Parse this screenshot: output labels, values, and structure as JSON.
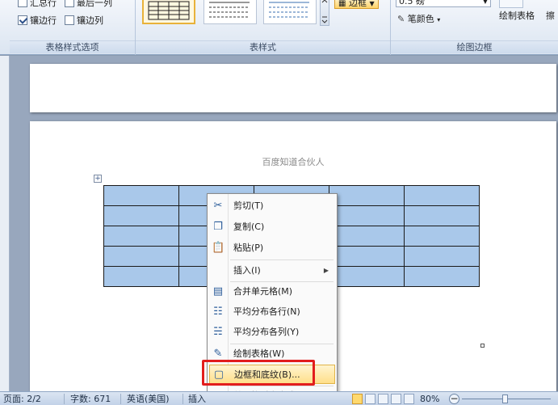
{
  "ribbon": {
    "style_options": {
      "caption": "表格样式选项",
      "items": [
        {
          "label": "汇总行",
          "checked": false
        },
        {
          "label": "最后一列",
          "checked": false
        },
        {
          "label": "镶边行",
          "checked": true
        },
        {
          "label": "镶边列",
          "checked": false
        }
      ]
    },
    "table_styles": {
      "caption": "表样式",
      "border_button": "边框"
    },
    "draw_borders": {
      "caption": "绘图边框",
      "pen_weight": "0.5 磅",
      "pen_color": "笔颜色",
      "draw_table": "绘制表格",
      "eraser": "擦"
    }
  },
  "document": {
    "header_text": "百度知道合伙人",
    "table": {
      "rows": 5,
      "cols": 5
    }
  },
  "context_menu": {
    "items": [
      {
        "label": "剪切(T)",
        "icon": "scissors-icon"
      },
      {
        "label": "复制(C)",
        "icon": "copy-icon"
      },
      {
        "label": "粘贴(P)",
        "icon": "paste-icon"
      },
      {
        "label": "插入(I)",
        "icon": "",
        "submenu": true
      },
      {
        "label": "合并单元格(M)",
        "icon": "merge-cells-icon"
      },
      {
        "label": "平均分布各行(N)",
        "icon": "distribute-rows-icon"
      },
      {
        "label": "平均分布各列(Y)",
        "icon": "distribute-columns-icon"
      },
      {
        "label": "绘制表格(W)",
        "icon": "draw-table-icon"
      },
      {
        "label": "边框和底纹(B)...",
        "icon": "borders-shading-icon",
        "highlighted": true
      },
      {
        "label": "单元格对齐方式(G)",
        "icon": "",
        "submenu": true
      }
    ]
  },
  "statusbar": {
    "page": "页面: 2/2",
    "words": "字数: 671",
    "language": "英语(美国)",
    "insert_mode": "插入",
    "zoom": "80%"
  }
}
